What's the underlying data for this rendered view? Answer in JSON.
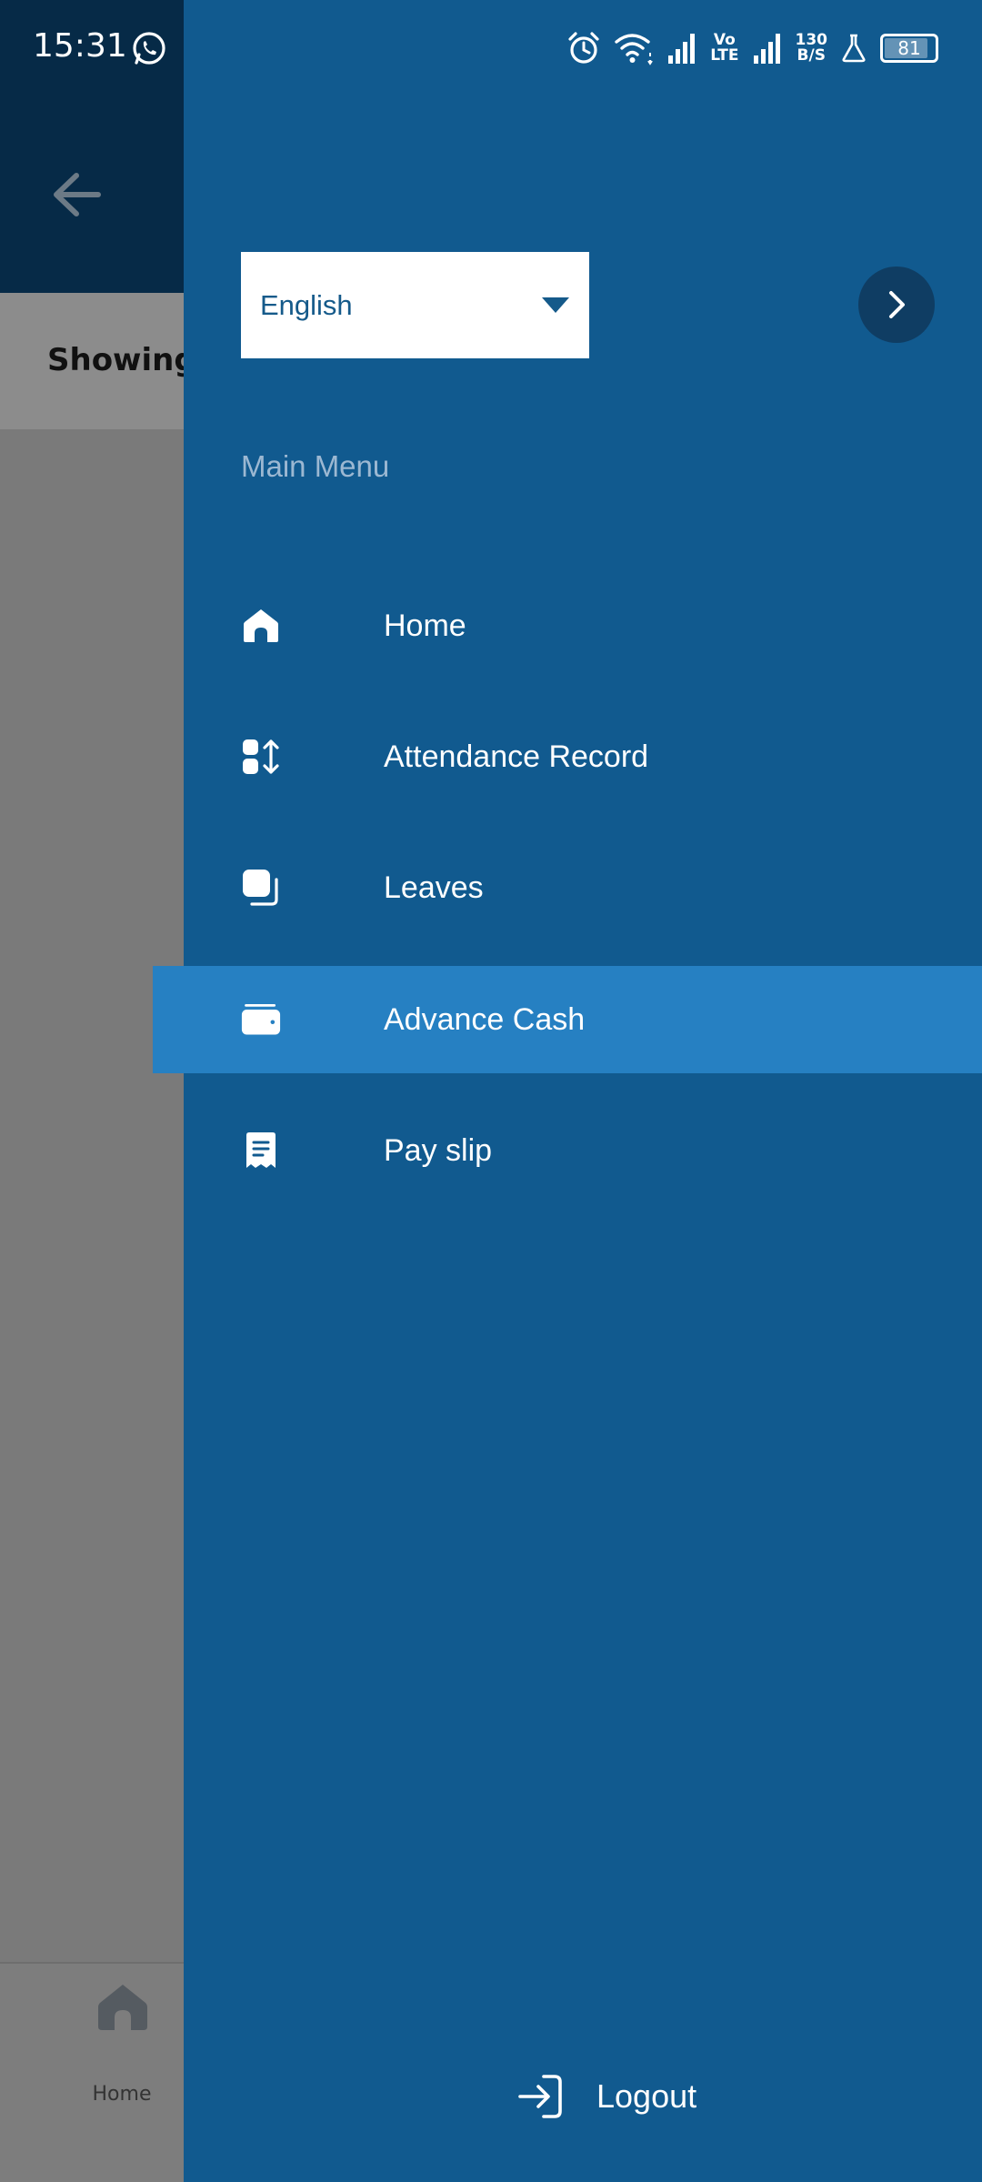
{
  "status_bar": {
    "time": "15:31",
    "volte_top": "Vo",
    "volte_bottom": "LTE",
    "net_speed_top": "130",
    "net_speed_bottom": "B/S",
    "battery_level": "81",
    "icons": [
      "whatsapp-icon",
      "alarm-icon",
      "wifi-icon",
      "signal-icon",
      "signal-icon",
      "flask-icon",
      "battery-icon"
    ]
  },
  "background_page": {
    "subheader_text": "Showing A",
    "bottom_nav": {
      "home_label": "Home"
    }
  },
  "drawer": {
    "language": {
      "selected": "English"
    },
    "menu_heading": "Main Menu",
    "items": [
      {
        "label": "Home",
        "icon": "home-icon",
        "active": false
      },
      {
        "label": "Attendance Record",
        "icon": "attendance-icon",
        "active": false
      },
      {
        "label": "Leaves",
        "icon": "leaves-icon",
        "active": false
      },
      {
        "label": "Advance Cash",
        "icon": "wallet-icon",
        "active": true
      },
      {
        "label": "Pay slip",
        "icon": "receipt-icon",
        "active": false
      }
    ],
    "logout_label": "Logout"
  },
  "colors": {
    "drawer_bg": "#115a8f",
    "active_item_bg": "#2680c2",
    "appbar_bg": "#062a47",
    "next_button_bg": "#0f3d63"
  }
}
